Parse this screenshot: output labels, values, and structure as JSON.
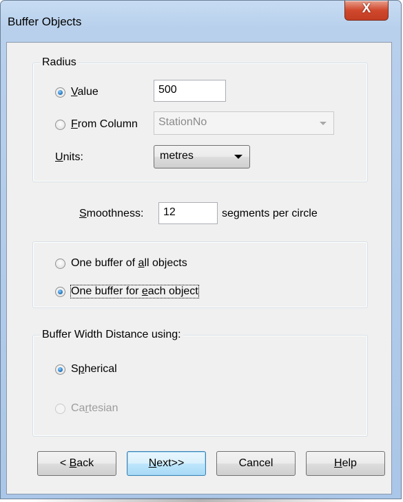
{
  "window": {
    "title": "Buffer Objects",
    "close_glyph": "X"
  },
  "radius": {
    "legend": "Radius",
    "value_option": {
      "prefix": "",
      "mnemonic": "V",
      "suffix": "alue",
      "checked": true
    },
    "value_input": "500",
    "column_option": {
      "prefix": "",
      "mnemonic": "F",
      "suffix": "rom Column",
      "checked": false
    },
    "column_select": "StationNo",
    "units_label": {
      "mnemonic": "U",
      "suffix": "nits:"
    },
    "units_select": "metres"
  },
  "smoothness": {
    "label_mnemonic": "S",
    "label_suffix": "moothness:",
    "value": "12",
    "suffix_text": "segments per circle"
  },
  "buffer_mode": {
    "option_all": {
      "prefix": "One buffer of ",
      "mnemonic": "a",
      "suffix": "ll objects",
      "checked": false
    },
    "option_each": {
      "prefix": "One buffer for ",
      "mnemonic": "e",
      "suffix": "ach object",
      "checked": true
    }
  },
  "distance": {
    "legend": "Buffer Width Distance using:",
    "spherical": {
      "prefix": "S",
      "mnemonic": "p",
      "suffix": "herical",
      "checked": true
    },
    "cartesian": {
      "prefix": "Ca",
      "mnemonic": "r",
      "suffix": "tesian",
      "checked": false,
      "disabled": true
    }
  },
  "buttons": {
    "back": {
      "prefix": "< ",
      "mnemonic": "B",
      "suffix": "ack"
    },
    "next": {
      "prefix": "",
      "mnemonic": "N",
      "suffix": "ext>>"
    },
    "cancel": "Cancel",
    "help": {
      "prefix": "",
      "mnemonic": "H",
      "suffix": "elp"
    }
  }
}
